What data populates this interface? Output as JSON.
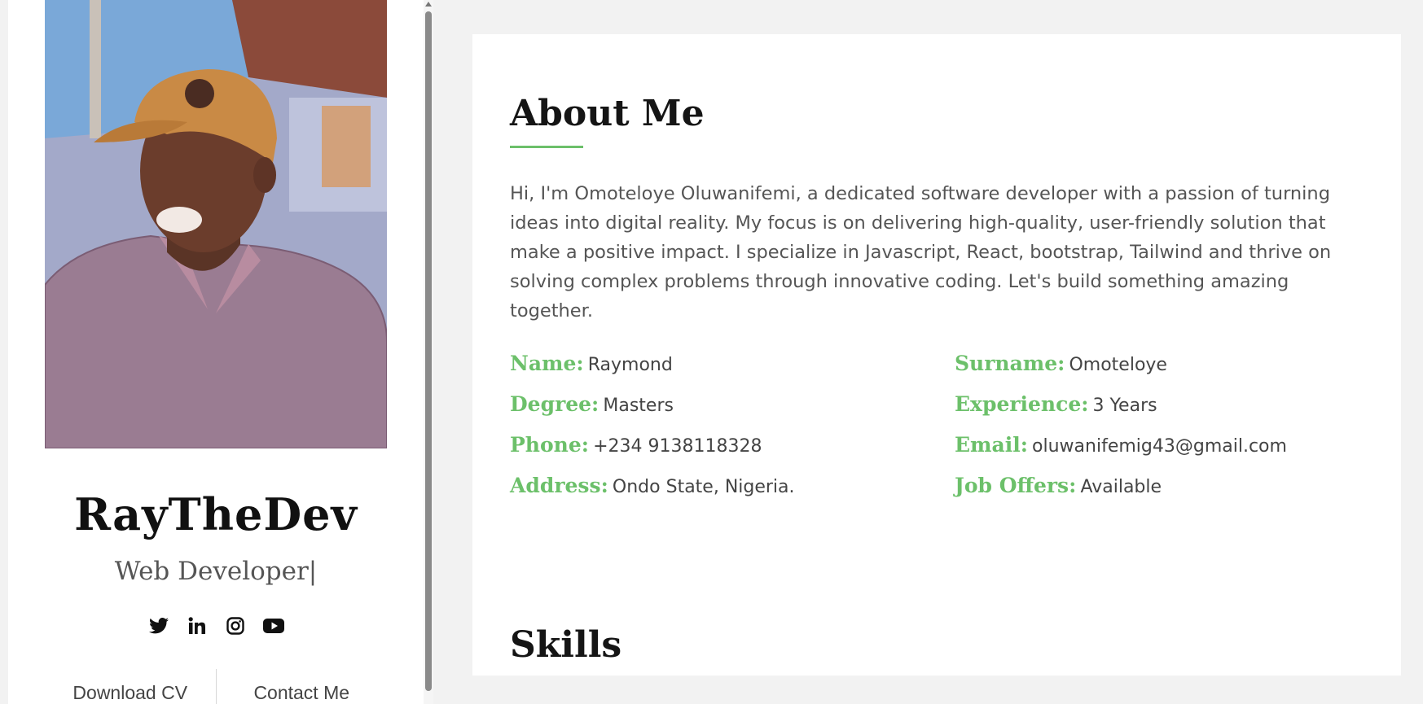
{
  "profile": {
    "name": "RayTheDev",
    "role": "Web Developer|",
    "socials": [
      {
        "icon": "twitter-icon"
      },
      {
        "icon": "linkedin-icon"
      },
      {
        "icon": "instagram-icon"
      },
      {
        "icon": "youtube-icon"
      }
    ],
    "buttons": {
      "download_cv": "Download CV",
      "contact_me": "Contact Me"
    }
  },
  "about": {
    "title": "About Me",
    "text": "Hi, I'm Omoteloye Oluwanifemi, a dedicated software developer with a passion of turning ideas into digital reality. My focus is on delivering high-quality, user-friendly solution that make a positive impact. I specialize in Javascript, React, bootstrap, Tailwind and thrive on solving complex problems through innovative coding. Let's build something amazing together.",
    "info": [
      {
        "label": "Name:",
        "value": "Raymond"
      },
      {
        "label": "Surname:",
        "value": "Omoteloye"
      },
      {
        "label": "Degree:",
        "value": "Masters"
      },
      {
        "label": "Experience:",
        "value": "3 Years"
      },
      {
        "label": "Phone:",
        "value": "+234 9138118328"
      },
      {
        "label": "Email:",
        "value": "oluwanifemig43@gmail.com"
      },
      {
        "label": "Address:",
        "value": "Ondo State, Nigeria."
      },
      {
        "label": "Job Offers:",
        "value": "Available"
      }
    ]
  },
  "skills": {
    "title": "Skills"
  },
  "colors": {
    "accent": "#6cc06a",
    "heading": "#151515",
    "body_text": "#555555",
    "page_bg": "#f2f2f2"
  }
}
